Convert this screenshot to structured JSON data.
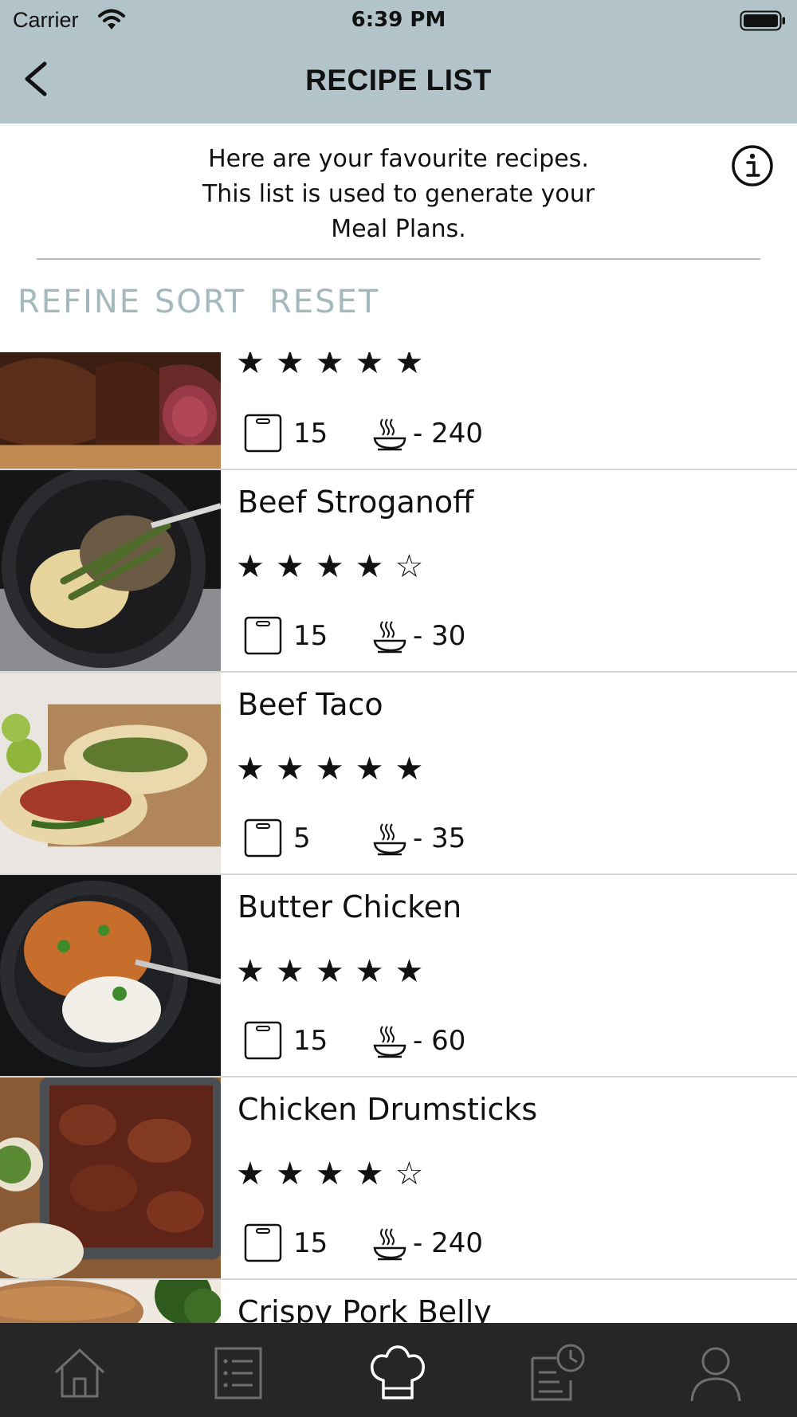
{
  "status_bar": {
    "carrier": "Carrier",
    "time": "6:39 PM"
  },
  "header": {
    "title": "RECIPE LIST"
  },
  "intro": {
    "line1": "Here are your favourite recipes.",
    "line2": "This list is used to generate your",
    "line3": "Meal Plans."
  },
  "filters": {
    "refine": "REFINE",
    "sort": "SORT",
    "reset": "RESET"
  },
  "recipes": [
    {
      "name": "",
      "rating": 5,
      "stars": "★★★★★",
      "prep": "15",
      "cook": "- 240"
    },
    {
      "name": "Beef Stroganoff",
      "rating": 4,
      "stars": "★★★★☆",
      "prep": "15",
      "cook": "- 30"
    },
    {
      "name": "Beef Taco",
      "rating": 5,
      "stars": "★★★★★",
      "prep": "5",
      "cook": "- 35"
    },
    {
      "name": "Butter Chicken",
      "rating": 5,
      "stars": "★★★★★",
      "prep": "15",
      "cook": "- 60"
    },
    {
      "name": "Chicken Drumsticks",
      "rating": 4,
      "stars": "★★★★☆",
      "prep": "15",
      "cook": "- 240"
    },
    {
      "name": "Crispy Pork Belly",
      "rating": 0,
      "stars": "",
      "prep": "",
      "cook": ""
    }
  ],
  "tabs": [
    "home-icon",
    "list-icon",
    "chef-hat-icon",
    "history-icon",
    "profile-icon"
  ],
  "colors": {
    "header_bg": "#b2c4ca",
    "filter_text": "#a3b9bd",
    "tabbar_bg": "#262626"
  }
}
